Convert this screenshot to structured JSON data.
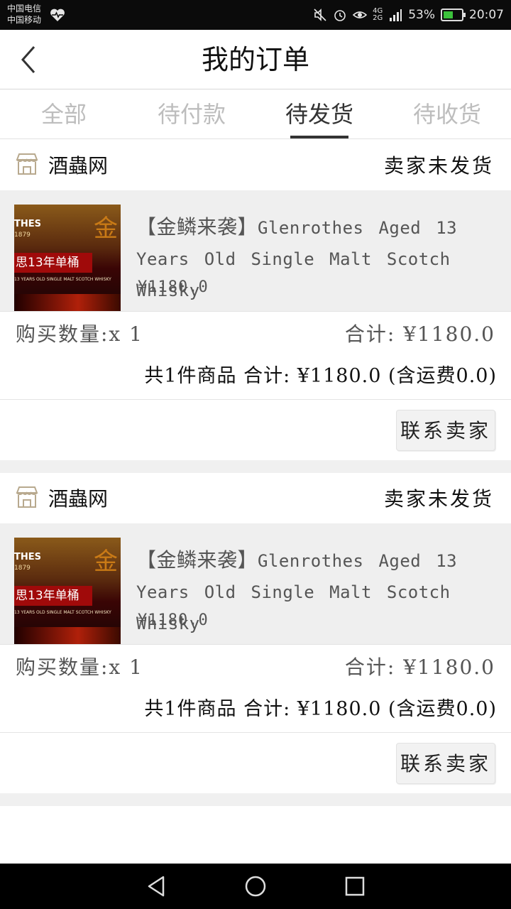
{
  "status_bar": {
    "carrier_1": "中国电信",
    "carrier_2": "中国移动",
    "battery": "53%",
    "battery_level": 0.53,
    "time": "20:07",
    "network_1": "4G",
    "network_2": "2G",
    "icons": [
      "heart-pulse-icon",
      "mute-icon",
      "alarm-icon",
      "eye-icon",
      "signal-icon",
      "battery-icon"
    ]
  },
  "header": {
    "title": "我的订单",
    "back_icon": "chevron-left-icon"
  },
  "tabs": [
    {
      "label": "全部",
      "active": false
    },
    {
      "label": "待付款",
      "active": false
    },
    {
      "label": "待发货",
      "active": true
    },
    {
      "label": "待收货",
      "active": false
    }
  ],
  "orders": [
    {
      "shop_name": "酒蟲网",
      "status": "卖家未发货",
      "product": {
        "name_cn": "【金鳞来袭】",
        "name_en": "Glenrothes Aged 13 Years Old Single Malt Scotch Whisky",
        "price": "¥1180.0",
        "thumb_text": [
          "THES",
          "1879",
          "思13年单桶",
          "13 YEARS OLD SINGLE MALT SCOTCH WHISKY",
          "金"
        ]
      },
      "quantity": "购买数量:x 1",
      "subtotal": "合计: ¥1180.0",
      "summary": "共1件商品 合计: ¥1180.0 (含运费0.0)",
      "action": "联系卖家"
    },
    {
      "shop_name": "酒蟲网",
      "status": "卖家未发货",
      "product": {
        "name_cn": "【金鳞来袭】",
        "name_en": "Glenrothes Aged 13 Years Old Single Malt Scotch Whisky",
        "price": "¥1180.0",
        "thumb_text": [
          "THES",
          "1879",
          "思13年单桶",
          "13 YEARS OLD SINGLE MALT SCOTCH WHISKY",
          "金"
        ]
      },
      "quantity": "购买数量:x 1",
      "subtotal": "合计: ¥1180.0",
      "summary": "共1件商品 合计: ¥1180.0 (含运费0.0)",
      "action": "联系卖家"
    }
  ],
  "nav_bar": {
    "back": "triangle-back-icon",
    "home": "circle-home-icon",
    "recents": "square-recents-icon"
  }
}
